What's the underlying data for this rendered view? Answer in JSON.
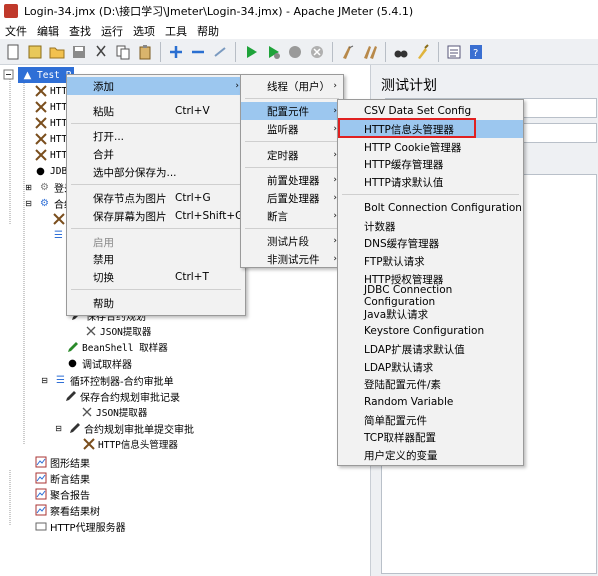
{
  "window": {
    "title": "Login-34.jmx (D:\\接口学习\\Jmeter\\Login-34.jmx) - Apache JMeter (5.4.1)"
  },
  "menubar": [
    "文件",
    "编辑",
    "查找",
    "运行",
    "选项",
    "工具",
    "帮助"
  ],
  "toolbar_icons": [
    "new-icon",
    "templates-icon",
    "open-icon",
    "save-icon",
    "cut-icon",
    "copy-icon",
    "paste-icon",
    "expand-icon",
    "collapse-icon",
    "toggle-icon",
    "start-icon",
    "start-no-pause-icon",
    "stop-icon",
    "shutdown-icon",
    "clear-icon",
    "clear-all-icon",
    "search-icon",
    "reset-search-icon",
    "function-helper-icon",
    "help-icon"
  ],
  "tree": {
    "root": "Test P",
    "items": [
      {
        "label": "HTTP",
        "icon": "tools-icon"
      },
      {
        "label": "HTTP",
        "icon": "tools-icon"
      },
      {
        "label": "HTTP",
        "icon": "tools-icon"
      },
      {
        "label": "HTTP",
        "icon": "tools-icon"
      },
      {
        "label": "HTTP",
        "icon": "tools-icon"
      },
      {
        "label": "JDBC",
        "icon": "dot-icon"
      },
      {
        "label": "登录",
        "icon": "gear-icon"
      },
      {
        "label": "合约",
        "icon": "gear-icon"
      },
      {
        "label": "保存合约规划",
        "icon": "pen-icon"
      },
      {
        "label": "JSON提取器",
        "icon": "extractor-icon"
      },
      {
        "label": "BeanShell 取样器",
        "icon": "pen-icon"
      },
      {
        "label": "调试取样器",
        "icon": "dot-icon"
      },
      {
        "label": "循环控制器-合约审批单",
        "icon": "loop-icon"
      },
      {
        "label": "保存合约规划审批记录",
        "icon": "pen-icon"
      },
      {
        "label": "JSON提取器",
        "icon": "extractor-icon"
      },
      {
        "label": "合约规划审批单提交审批",
        "icon": "pen-icon"
      },
      {
        "label": "HTTP信息头管理器",
        "icon": "tools-icon"
      },
      {
        "label": "图形结果",
        "icon": "graph-icon"
      },
      {
        "label": "断言结果",
        "icon": "graph-icon"
      },
      {
        "label": "聚合报告",
        "icon": "graph-icon"
      },
      {
        "label": "察看结果树",
        "icon": "graph-icon"
      },
      {
        "label": "HTTP代理服务器",
        "icon": "proxy-icon"
      }
    ]
  },
  "right_panel": {
    "title": "测试计划"
  },
  "context_menu": {
    "items": [
      {
        "label": "添加",
        "shortcut": "",
        "submenu": true,
        "selected": true,
        "disabled": false
      },
      {
        "label": "粘贴",
        "shortcut": "Ctrl+V",
        "submenu": false,
        "selected": false,
        "disabled": false
      },
      {
        "label": "打开...",
        "shortcut": "",
        "submenu": false,
        "selected": false,
        "disabled": false
      },
      {
        "label": "合并",
        "shortcut": "",
        "submenu": false,
        "selected": false,
        "disabled": false
      },
      {
        "label": "选中部分保存为...",
        "shortcut": "",
        "submenu": false,
        "selected": false,
        "disabled": false
      },
      {
        "label": "保存节点为图片",
        "shortcut": "Ctrl+G",
        "submenu": false,
        "selected": false,
        "disabled": false
      },
      {
        "label": "保存屏幕为图片",
        "shortcut": "Ctrl+Shift+G",
        "submenu": false,
        "selected": false,
        "disabled": false
      },
      {
        "label": "启用",
        "shortcut": "",
        "submenu": false,
        "selected": false,
        "disabled": true
      },
      {
        "label": "禁用",
        "shortcut": "",
        "submenu": false,
        "selected": false,
        "disabled": false
      },
      {
        "label": "切换",
        "shortcut": "Ctrl+T",
        "submenu": false,
        "selected": false,
        "disabled": false
      },
      {
        "label": "帮助",
        "shortcut": "",
        "submenu": false,
        "selected": false,
        "disabled": false
      }
    ]
  },
  "add_submenu": {
    "items": [
      {
        "label": "线程（用户）",
        "selected": false
      },
      {
        "label": "配置元件",
        "selected": true
      },
      {
        "label": "监听器",
        "selected": false
      },
      {
        "label": "定时器",
        "selected": false
      },
      {
        "label": "前置处理器",
        "selected": false
      },
      {
        "label": "后置处理器",
        "selected": false
      },
      {
        "label": "断言",
        "selected": false
      },
      {
        "label": "测试片段",
        "selected": false
      },
      {
        "label": "非测试元件",
        "selected": false
      }
    ]
  },
  "config_submenu": {
    "items": [
      {
        "label": "CSV Data Set Config",
        "selected": false
      },
      {
        "label": "HTTP信息头管理器",
        "selected": true
      },
      {
        "label": "HTTP Cookie管理器",
        "selected": false
      },
      {
        "label": "HTTP缓存管理器",
        "selected": false
      },
      {
        "label": "HTTP请求默认值",
        "selected": false
      },
      {
        "label": "Bolt Connection Configuration",
        "selected": false
      },
      {
        "label": "计数器",
        "selected": false
      },
      {
        "label": "DNS缓存管理器",
        "selected": false
      },
      {
        "label": "FTP默认请求",
        "selected": false
      },
      {
        "label": "HTTP授权管理器",
        "selected": false
      },
      {
        "label": "JDBC Connection Configuration",
        "selected": false
      },
      {
        "label": "Java默认请求",
        "selected": false
      },
      {
        "label": "Keystore Configuration",
        "selected": false
      },
      {
        "label": "LDAP扩展请求默认值",
        "selected": false
      },
      {
        "label": "LDAP默认请求",
        "selected": false
      },
      {
        "label": "登陆配置元件/素",
        "selected": false
      },
      {
        "label": "Random Variable",
        "selected": false
      },
      {
        "label": "简单配置元件",
        "selected": false
      },
      {
        "label": "TCP取样器配置",
        "selected": false
      },
      {
        "label": "用户定义的变量",
        "selected": false
      }
    ]
  },
  "colors": {
    "selection": "#9cc7ef",
    "highlight_box": "#e02020",
    "menu_bg": "#f2f2f2"
  }
}
